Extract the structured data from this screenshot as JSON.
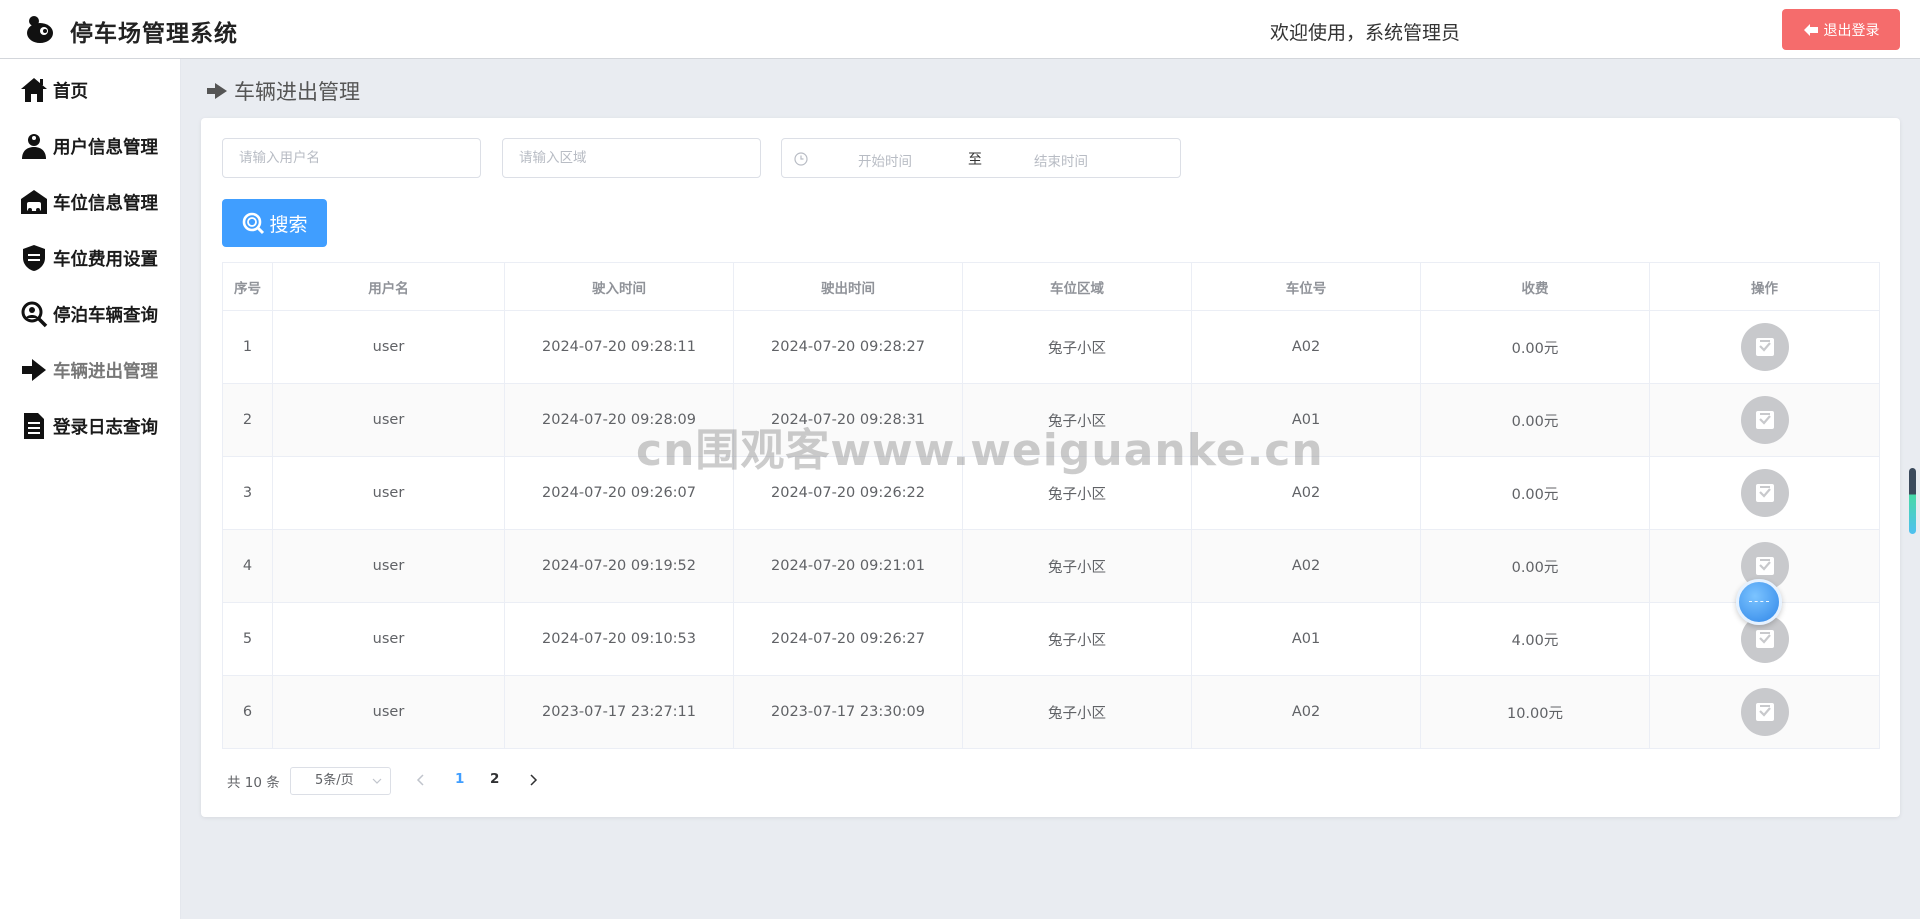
{
  "app": {
    "title": "停车场管理系统",
    "logo_icon": "bird-logo-icon"
  },
  "header": {
    "welcome": "欢迎使用，系统管理员",
    "logout_label": "退出登录",
    "logout_color": "#f56c6c"
  },
  "sidebar": {
    "items": [
      {
        "label": "首页",
        "icon": "home-icon",
        "active": false
      },
      {
        "label": "用户信息管理",
        "icon": "user-icon",
        "active": false
      },
      {
        "label": "车位信息管理",
        "icon": "garage-icon",
        "active": false
      },
      {
        "label": "车位费用设置",
        "icon": "badge-icon",
        "active": false
      },
      {
        "label": "停泊车辆查询",
        "icon": "search-user-icon",
        "active": false
      },
      {
        "label": "车辆进出管理",
        "icon": "arrow-right-icon",
        "active": true
      },
      {
        "label": "登录日志查询",
        "icon": "document-icon",
        "active": false
      }
    ]
  },
  "page": {
    "title": "车辆进出管理"
  },
  "filters": {
    "username_placeholder": "请输入用户名",
    "area_placeholder": "请输入区域",
    "start_placeholder": "开始时间",
    "range_separator": "至",
    "end_placeholder": "结束时间",
    "search_label": "搜索",
    "accent_color": "#409eff"
  },
  "table": {
    "headers": [
      "序号",
      "用户名",
      "驶入时间",
      "驶出时间",
      "车位区域",
      "车位号",
      "收费",
      "操作"
    ],
    "rows": [
      [
        "1",
        "user",
        "2024-07-20 09:28:11",
        "2024-07-20 09:28:27",
        "兔子小区",
        "A02",
        "0.00元"
      ],
      [
        "2",
        "user",
        "2024-07-20 09:28:09",
        "2024-07-20 09:28:31",
        "兔子小区",
        "A01",
        "0.00元"
      ],
      [
        "3",
        "user",
        "2024-07-20 09:26:07",
        "2024-07-20 09:26:22",
        "兔子小区",
        "A02",
        "0.00元"
      ],
      [
        "4",
        "user",
        "2024-07-20 09:19:52",
        "2024-07-20 09:21:01",
        "兔子小区",
        "A02",
        "0.00元"
      ],
      [
        "5",
        "user",
        "2024-07-20 09:10:53",
        "2024-07-20 09:26:27",
        "兔子小区",
        "A01",
        "4.00元"
      ],
      [
        "6",
        "user",
        "2023-07-17 23:27:11",
        "2023-07-17 23:30:09",
        "兔子小区",
        "A02",
        "10.00元"
      ]
    ],
    "action_icon": "checkbox-icon"
  },
  "pagination": {
    "total": "共 10 条",
    "page_size": "5条/页",
    "pages": [
      "1",
      "2"
    ],
    "current": "1"
  },
  "watermark": "cn围观客www.weiguanke.cn"
}
